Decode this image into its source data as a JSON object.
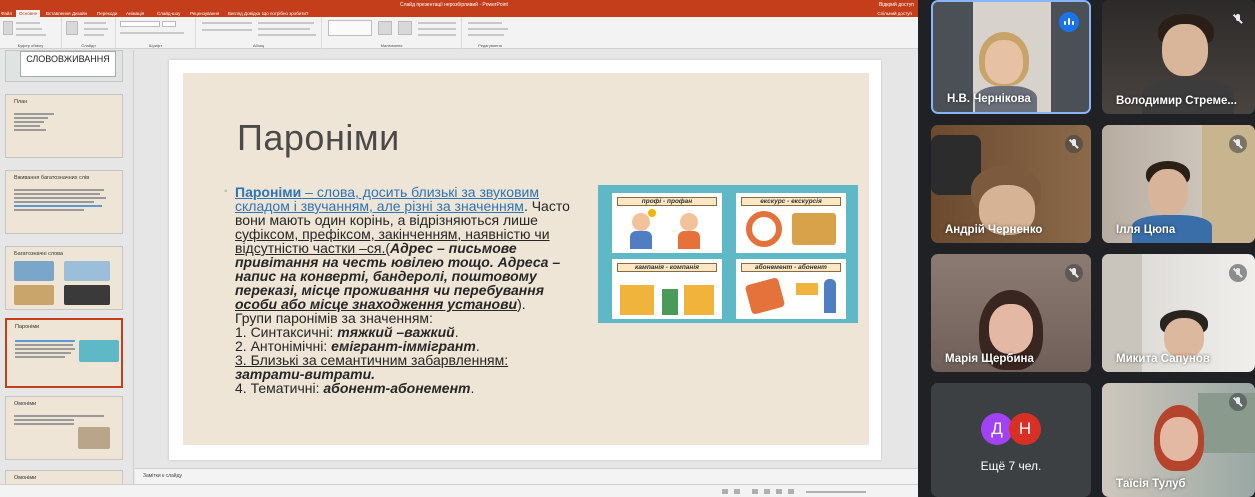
{
  "ppt": {
    "title_bar": {
      "document": "Слайд презентації нерозбірливий · PowerPoint",
      "user": "Відкрий доступ"
    },
    "ribbon": {
      "tabs": [
        "Файл",
        "Основне",
        "Вставлення",
        "Дизайн",
        "Переходи",
        "Анімація",
        "Слайд-шоу",
        "Рецензування",
        "Вигляд",
        "Довідка"
      ],
      "active_tab": "Основне",
      "search_hint": "Що потрібно зробити?",
      "share": "Спільний доступ",
      "groups": [
        "Буфер обміну",
        "Слайди",
        "Шрифт",
        "Абзац",
        "Малювання",
        "Редагування"
      ]
    },
    "thumbnails": [
      {
        "num": "",
        "title": "СЛОВОВЖИВАННЯ"
      },
      {
        "num": "2",
        "title": "План"
      },
      {
        "num": "3",
        "title": "Вживання багатозначних слів"
      },
      {
        "num": "4",
        "title": "Багатозначні слова"
      },
      {
        "num": "5",
        "title": "Пароніми"
      },
      {
        "num": "6",
        "title": "Омоніми"
      },
      {
        "num": "7",
        "title": "Омоніми"
      }
    ],
    "slide": {
      "title": "Пароніми",
      "body": {
        "bullet": "◦",
        "term": "Пароніми",
        "def_1": " – слова, досить близькі за звуковим",
        "def_2": "складом і звучанням, але різні за значенням",
        "def_3": ". Часто",
        "line_2": "вони мають один корінь, а відрізняються лише",
        "line_3": "суфіксом, префіксом, закінченням, наявністю чи",
        "line_4": "відсутністю частки –ся.(",
        "ex_1": "Адрес – письмове",
        "ex_2": "привітання на честь ювілею тощо. Адреса –",
        "ex_3": "напис на конверті, бандеролі, поштовому",
        "ex_4": "переказі, місце проживання чи перебування",
        "ex_5": "особи або місце знаходження установи",
        "ex_close": ").",
        "groups_header": "Групи паронімів за значенням:",
        "g1_label": "1. Синтаксичні: ",
        "g1_example": "тяжкий –важкий",
        "g2_label": "2. Антонімічні: ",
        "g2_example": "емігрант-іммігрант",
        "g3_label": "3. Близькі за семантичним забарвленням:",
        "g3_example": "затрати-витрати.",
        "g4_label": "4. Тематичні: ",
        "g4_example": "абонент-абонемент",
        "dot": "."
      },
      "image_captions": [
        "профі - профан",
        "екскурс - екскурсія",
        "кампанія - компанія",
        "абонемент - абонент"
      ]
    },
    "notes_placeholder": "Замітки к слайду"
  },
  "meet": {
    "participants": [
      {
        "name": "Н.В. Чернікова",
        "mic": "speaking"
      },
      {
        "name": "Володимир Стреме...",
        "mic": "muted"
      },
      {
        "name": "Андрій Черненко",
        "mic": "muted"
      },
      {
        "name": "Ілля Цюпа",
        "mic": "muted"
      },
      {
        "name": "Марія Щербина",
        "mic": "muted"
      },
      {
        "name": "Микита Сапунов",
        "mic": "muted"
      },
      {
        "name": "Тaїсія Тулуб",
        "mic": "muted"
      }
    ],
    "more": {
      "avatars": [
        "Д",
        "Н"
      ],
      "avatar_colors": [
        "#a142f4",
        "#d93025"
      ],
      "label": "Ещё 7 чел."
    },
    "colors": {
      "speaking": "#1a73e8",
      "tile_bg": "#3c4043",
      "page_bg": "#202124"
    }
  }
}
